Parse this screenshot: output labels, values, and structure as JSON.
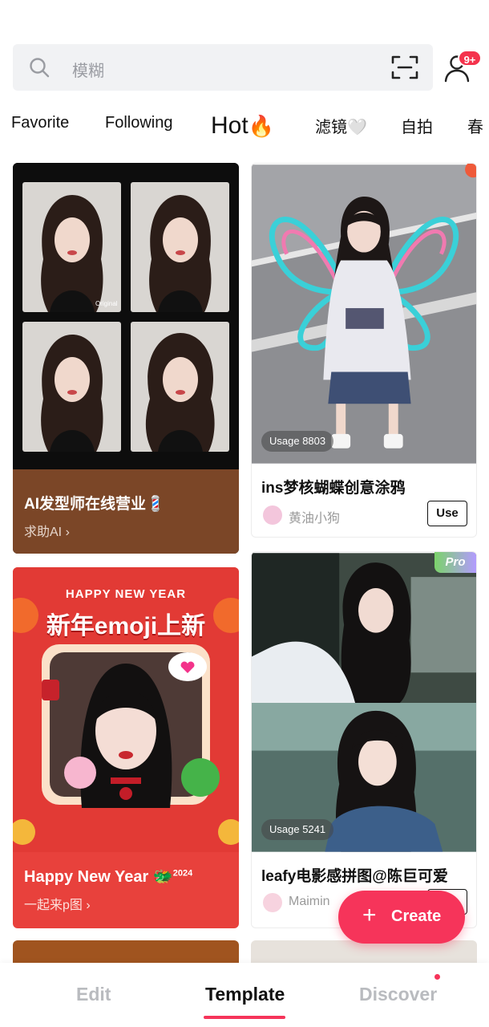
{
  "search": {
    "placeholder": "模糊",
    "badge": "9+"
  },
  "tabs": [
    {
      "label": "Favorite"
    },
    {
      "label": "Following"
    },
    {
      "label": "Hot",
      "emoji": "🔥"
    },
    {
      "label": "滤镜",
      "emoji": "🤍"
    },
    {
      "label": "自拍"
    },
    {
      "label": "春"
    }
  ],
  "cards": {
    "hair": {
      "title": "AI发型师在线营业💈",
      "subtitle": "求助AI",
      "image_label": "Original",
      "bg_color": "#7b4627"
    },
    "butterfly": {
      "usage": "Usage 8803",
      "title": "ins梦核蝴蝶创意涂鸦",
      "author": "黄油小狗",
      "use_label": "Use"
    },
    "newyear": {
      "header": "HAPPY NEW YEAR",
      "headline": "新年emoji上新",
      "title": "Happy New Year 🐲",
      "title_sup": "2024",
      "subtitle": "一起来p图",
      "bg_color": "#e8413c"
    },
    "leafy": {
      "pro": "Pro",
      "usage": "Usage 5241",
      "title": "leafy电影感拼图@陈巨可爱",
      "author": "Maimin",
      "use_label": "Use"
    }
  },
  "fab": {
    "plus": "+",
    "label": "Create"
  },
  "nav": {
    "edit": "Edit",
    "template": "Template",
    "discover": "Discover"
  },
  "colors": {
    "accent": "#f6345a",
    "badge": "#f4334d"
  }
}
